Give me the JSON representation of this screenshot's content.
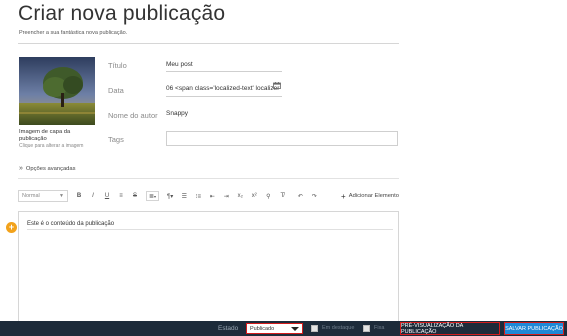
{
  "header": {
    "title": "Criar nova publicação",
    "subtitle": "Preencher a sua fantástica nova publicação."
  },
  "cover": {
    "label": "Imagem de capa da publicação",
    "hint": "Clique para alterar a imagem"
  },
  "form": {
    "title_label": "Título",
    "title_value": "Meu post",
    "date_label": "Data",
    "date_value": "06 <span class='localized-text' localizer",
    "author_label": "Nome do autor",
    "author_value": "Snappy",
    "tags_label": "Tags",
    "tags_value": ""
  },
  "advanced": {
    "label": "Opções avançadas"
  },
  "toolbar": {
    "style_value": "Normal",
    "bold": "B",
    "italic": "I",
    "underline": "U",
    "strike": "S",
    "subscript": "x₂",
    "superscript": "x²",
    "add_element": "Adicionar Elemento"
  },
  "editor": {
    "content": "Este é o conteúdo da publicação"
  },
  "bottom_bar": {
    "state_label": "Estado",
    "state_value": "Publicado",
    "featured_label": "Em destaque",
    "pinned_label": "Fixa",
    "preview_label": "PRÉ-VISUALIZAÇÃO DA PUBLICAÇÃO",
    "save_label": "SALVAR PUBLICAÇÃO"
  },
  "colors": {
    "bottom_bar_bg": "#1d2b3a",
    "save_button": "#1e88d6",
    "highlight_border": "#d21c1c",
    "add_circle": "#f2a21b"
  }
}
